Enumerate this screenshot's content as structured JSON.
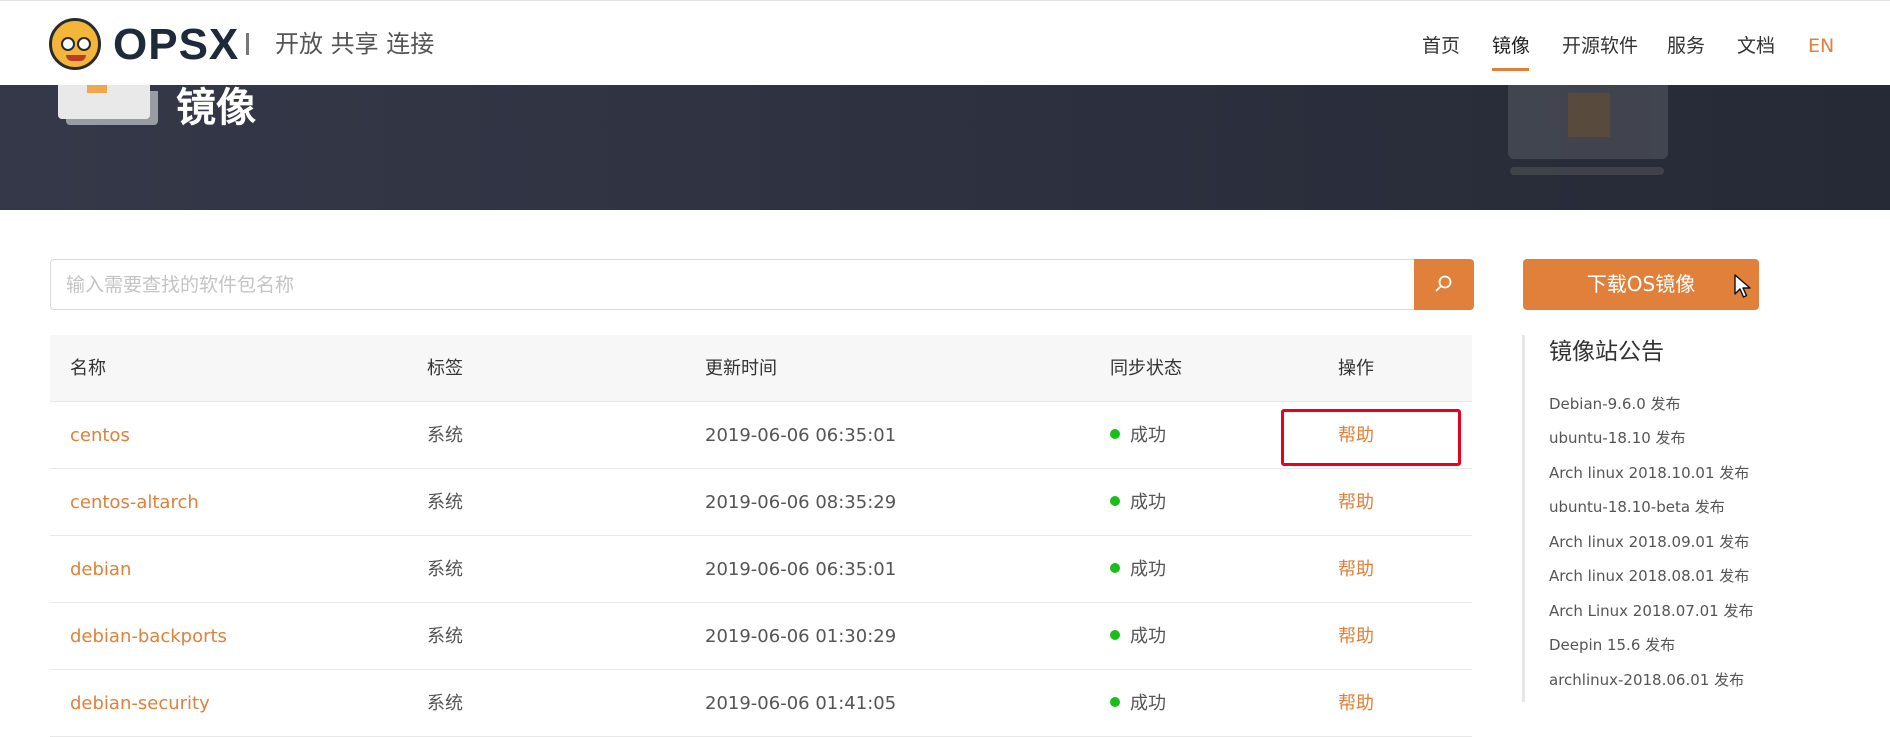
{
  "header": {
    "logo_text": "OPSX",
    "slogan": "开放 共享 连接",
    "nav": [
      {
        "label": "首页"
      },
      {
        "label": "镜像"
      },
      {
        "label": "开源软件"
      },
      {
        "label": "服务"
      },
      {
        "label": "文档"
      },
      {
        "label": "EN"
      }
    ],
    "active_nav": "镜像"
  },
  "banner": {
    "title": "镜像"
  },
  "search": {
    "placeholder": "输入需要查找的软件包名称",
    "value": ""
  },
  "table": {
    "columns": [
      "名称",
      "标签",
      "更新时间",
      "同步状态",
      "操作"
    ],
    "rows": [
      {
        "name": "centos",
        "tag": "系统",
        "updated": "2019-06-06 06:35:01",
        "status": "成功",
        "action": "帮助"
      },
      {
        "name": "centos-altarch",
        "tag": "系统",
        "updated": "2019-06-06 08:35:29",
        "status": "成功",
        "action": "帮助"
      },
      {
        "name": "debian",
        "tag": "系统",
        "updated": "2019-06-06 06:35:01",
        "status": "成功",
        "action": "帮助"
      },
      {
        "name": "debian-backports",
        "tag": "系统",
        "updated": "2019-06-06 01:30:29",
        "status": "成功",
        "action": "帮助"
      },
      {
        "name": "debian-security",
        "tag": "系统",
        "updated": "2019-06-06 01:41:05",
        "status": "成功",
        "action": "帮助"
      }
    ]
  },
  "sidebar": {
    "download_button": "下载OS镜像",
    "notice_title": "镜像站公告",
    "notices": [
      "Debian-9.6.0 发布",
      "ubuntu-18.10 发布",
      "Arch linux 2018.10.01 发布",
      "ubuntu-18.10-beta 发布",
      "Arch linux 2018.09.01 发布",
      "Arch linux 2018.08.01 发布",
      "Arch Linux 2018.07.01 发布",
      "Deepin 15.6 发布",
      "archlinux-2018.06.01 发布"
    ]
  },
  "colors": {
    "accent": "#e0803a",
    "banner_bg": "#2c303e",
    "status_success": "#19be19",
    "highlight": "#e8001e"
  }
}
